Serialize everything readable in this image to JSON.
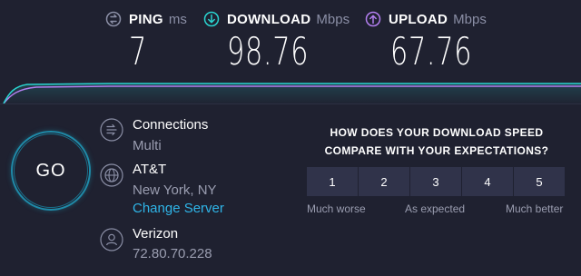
{
  "stats": {
    "ping": {
      "label": "PING",
      "unit": "ms",
      "value": "7",
      "icon": "ping-icon",
      "color": "#8b8fa6"
    },
    "download": {
      "label": "DOWNLOAD",
      "unit": "Mbps",
      "value": "98.76",
      "icon": "download-icon",
      "color": "#2ad4d0"
    },
    "upload": {
      "label": "UPLOAD",
      "unit": "Mbps",
      "value": "67.76",
      "icon": "upload-icon",
      "color": "#b37ff0"
    }
  },
  "go": {
    "label": "GO"
  },
  "connections": {
    "title": "Connections",
    "value": "Multi",
    "icon": "connections-icon"
  },
  "isp": {
    "name": "AT&T",
    "location": "New York, NY",
    "change_label": "Change Server",
    "icon": "globe-icon"
  },
  "host": {
    "name": "Verizon",
    "ip": "72.80.70.228",
    "icon": "person-icon"
  },
  "survey": {
    "question_line1": "HOW DOES YOUR DOWNLOAD SPEED",
    "question_line2": "COMPARE WITH YOUR EXPECTATIONS?",
    "options": [
      "1",
      "2",
      "3",
      "4",
      "5"
    ],
    "low_label": "Much worse",
    "mid_label": "As expected",
    "high_label": "Much better"
  },
  "colors": {
    "background": "#1f2130",
    "accent": "#2fb5e8",
    "button": "#30334a"
  }
}
